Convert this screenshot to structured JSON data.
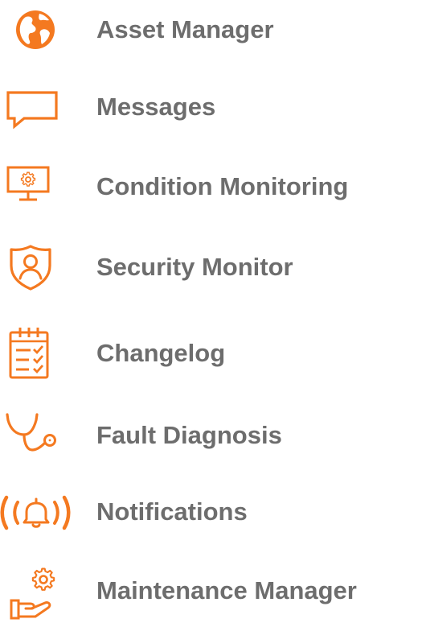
{
  "accent_color": "#f47920",
  "text_color": "#6d6d6d",
  "menu": {
    "items": [
      {
        "label": "Asset Manager",
        "icon": "globe-icon"
      },
      {
        "label": "Messages",
        "icon": "message-bubble-icon"
      },
      {
        "label": "Condition Monitoring",
        "icon": "monitor-gear-icon"
      },
      {
        "label": "Security Monitor",
        "icon": "shield-user-icon"
      },
      {
        "label": "Changelog",
        "icon": "clipboard-checklist-icon"
      },
      {
        "label": "Fault Diagnosis",
        "icon": "stethoscope-icon"
      },
      {
        "label": "Notifications",
        "icon": "ringing-bell-icon"
      },
      {
        "label": "Maintenance Manager",
        "icon": "hand-gear-icon"
      }
    ]
  }
}
